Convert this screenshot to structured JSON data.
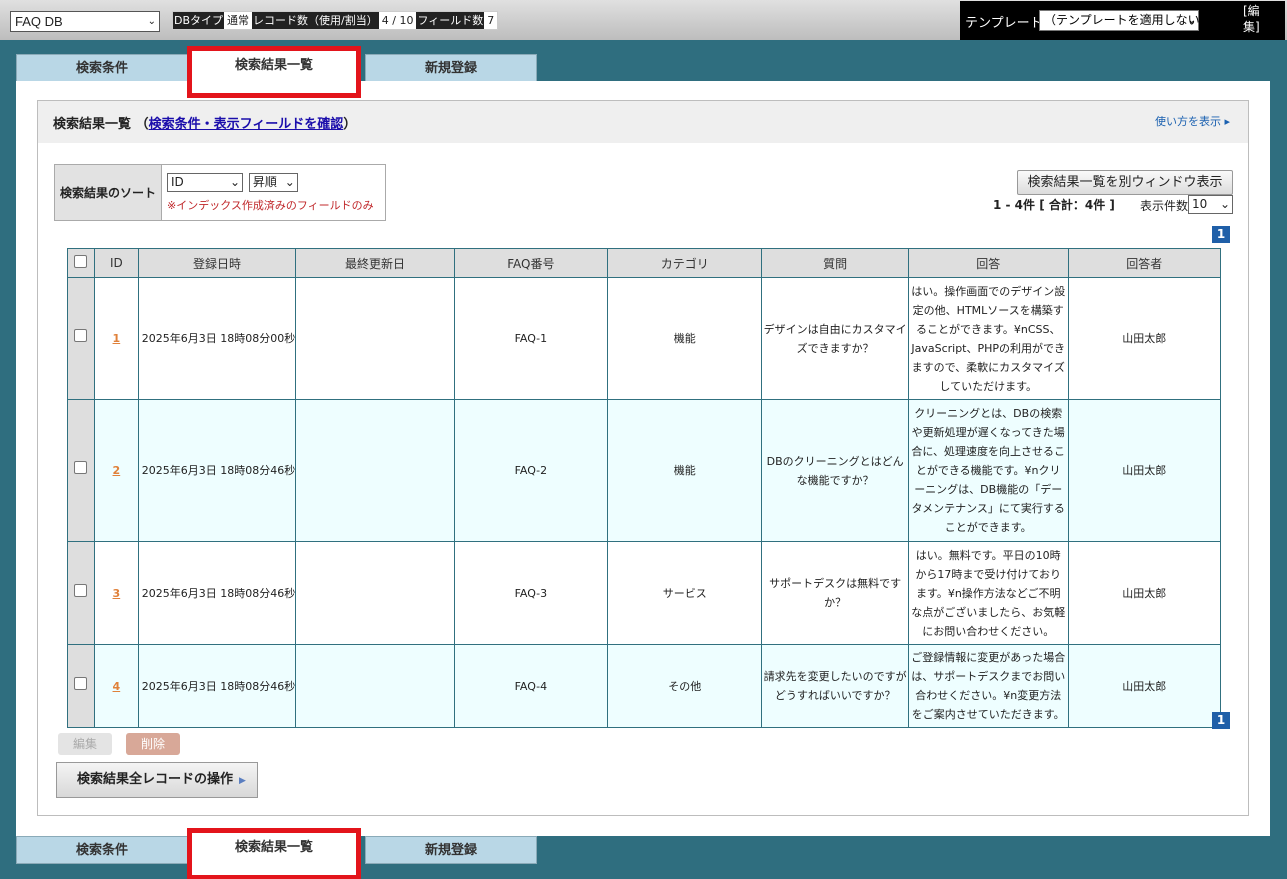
{
  "topbar": {
    "db_select": "FAQ DB",
    "db_type_label": "DBタイプ",
    "db_type_value": "通常",
    "record_label": "レコード数（使用/割当）",
    "record_value": "4 / 10",
    "field_label": "フィールド数",
    "field_value": "7",
    "template_label": "テンプレート",
    "template_value": "（テンプレートを適用しない）",
    "edit_label": "[編集]"
  },
  "tabs": [
    {
      "label": "検索条件"
    },
    {
      "label": "検索結果一覧"
    },
    {
      "label": "新規登録"
    }
  ],
  "header": {
    "title": "検索結果一覧",
    "link": "検索条件・表示フィールドを確認",
    "open_paren": "（",
    "close_paren": "）",
    "howto": "使い方を表示 ▸"
  },
  "sort": {
    "label": "検索結果のソート",
    "field": "ID",
    "order": "昇順",
    "note": "※インデックス作成済みのフィールドのみ"
  },
  "open_window_button": "検索結果一覧を別ウィンドウ表示",
  "count_text": "1 - 4件 [ 合計：4件 ]",
  "per_page_label": "表示件数",
  "per_page_value": "10",
  "pager_page": "1",
  "columns": [
    "ID",
    "登録日時",
    "最終更新日",
    "FAQ番号",
    "カテゴリ",
    "質問",
    "回答",
    "回答者"
  ],
  "rows": [
    {
      "id": "1",
      "registered": "2025年6月3日 18時08分00秒",
      "updated": "",
      "faq_no": "FAQ-1",
      "category": "機能",
      "question": "デザインは自由にカスタマイズできますか？",
      "answer": "はい。操作画面でのデザイン設定の他、HTMLソースを構築することができます。¥nCSS、JavaScript、PHPの利用ができますので、柔軟にカスタマイズしていただけます。",
      "responder": "山田太郎"
    },
    {
      "id": "2",
      "registered": "2025年6月3日 18時08分46秒",
      "updated": "",
      "faq_no": "FAQ-2",
      "category": "機能",
      "question": "DBのクリーニングとはどんな機能ですか？",
      "answer": "クリーニングとは、DBの検索や更新処理が遅くなってきた場合に、処理速度を向上させることができる機能です。¥nクリーニングは、DB機能の「データメンテナンス」にて実行することができます。",
      "responder": "山田太郎"
    },
    {
      "id": "3",
      "registered": "2025年6月3日 18時08分46秒",
      "updated": "",
      "faq_no": "FAQ-3",
      "category": "サービス",
      "question": "サポートデスクは無料ですか？",
      "answer": "はい。無料です。平日の10時から17時まで受け付けております。¥n操作方法などご不明な点がございましたら、お気軽にお問い合わせください。",
      "responder": "山田太郎"
    },
    {
      "id": "4",
      "registered": "2025年6月3日 18時08分46秒",
      "updated": "",
      "faq_no": "FAQ-4",
      "category": "その他",
      "question": "請求先を変更したいのですがどうすればいいですか？",
      "answer": "ご登録情報に変更があった場合は、サポートデスクまでお問い合わせください。¥n変更方法をご案内させていただきます。",
      "responder": "山田太郎"
    }
  ],
  "buttons": {
    "edit": "編集",
    "delete": "削除",
    "all_ops": "検索結果全レコードの操作"
  }
}
